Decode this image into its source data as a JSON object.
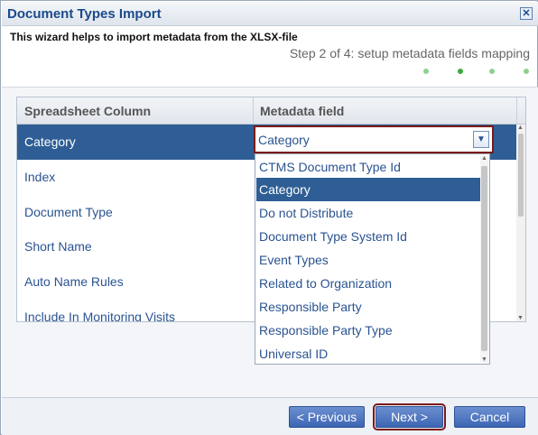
{
  "dialog": {
    "title": "Document Types Import",
    "close_icon": "close-icon"
  },
  "wizard": {
    "intro": "This wizard helps to import metadata from the XLSX-file",
    "step_text": "Step 2 of 4: setup metadata fields mapping",
    "step_count": 4,
    "current_step": 2
  },
  "grid": {
    "headers": [
      "Spreadsheet Column",
      "Metadata field"
    ],
    "rows": [
      {
        "label": "Category",
        "selected": true
      },
      {
        "label": "Index"
      },
      {
        "label": "Document Type"
      },
      {
        "label": "Short Name"
      },
      {
        "label": "Auto Name Rules"
      },
      {
        "label": "Include In Monitoring Visits"
      }
    ]
  },
  "select": {
    "value": "Category",
    "icon": "chevron-down-icon"
  },
  "dropdown": {
    "options": [
      "CTMS Document Type Id",
      "Category",
      "Do not Distribute",
      "Document Type System Id",
      "Event Types",
      "Related to Organization",
      "Responsible Party",
      "Responsible Party Type",
      "Universal ID"
    ],
    "selected_index": 1
  },
  "buttons": {
    "previous": "< Previous",
    "next": "Next >",
    "cancel": "Cancel"
  },
  "colors": {
    "accent": "#2e5e95",
    "highlight_border": "#7b1a1a",
    "step_done": "#8fd08f",
    "step_current": "#3fa93f"
  }
}
